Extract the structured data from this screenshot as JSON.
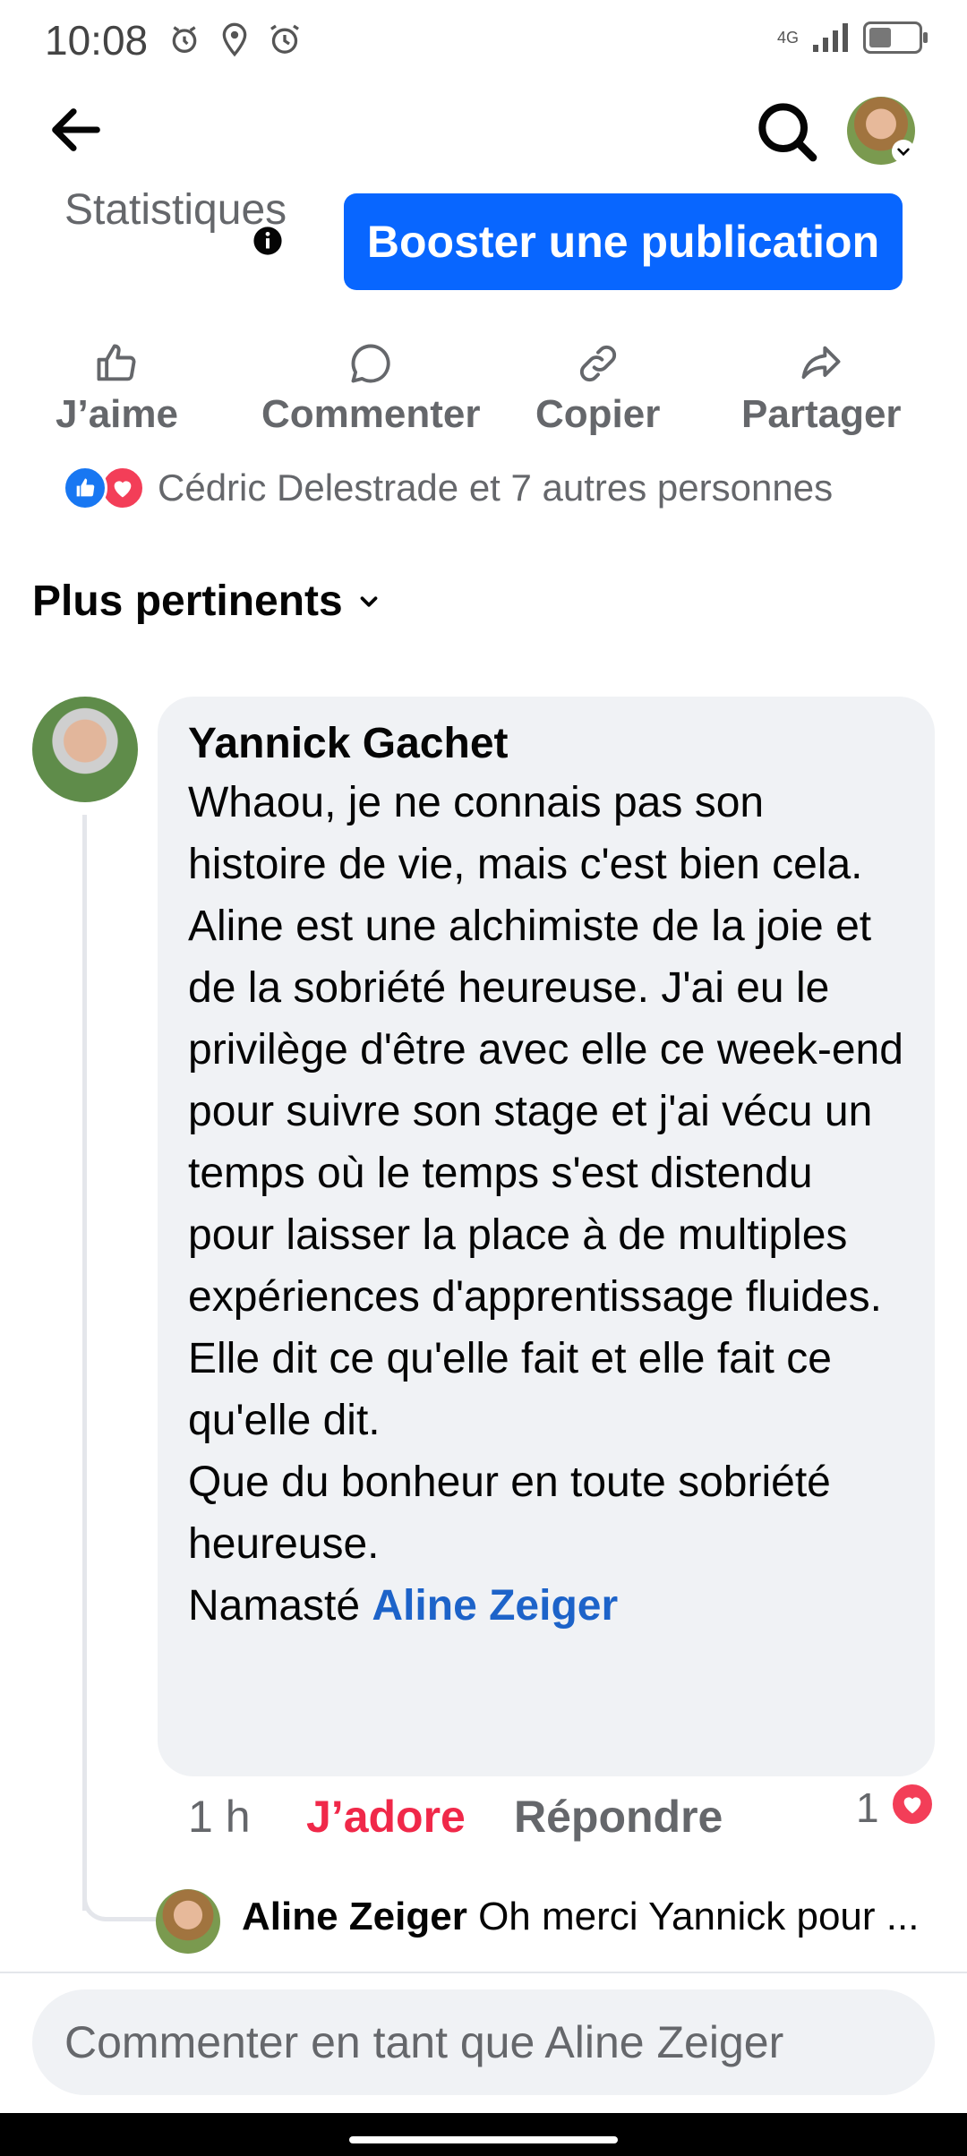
{
  "status_bar": {
    "time": "10:08",
    "network": "4G",
    "battery_level": 0.45
  },
  "header": {
    "back_icon": "arrow-left-icon",
    "search_icon": "search-icon"
  },
  "stats": {
    "label": "Statistiques",
    "boost_label": "Booster une publication"
  },
  "actions": [
    {
      "label": "J’aime",
      "icon": "thumbs-up-icon"
    },
    {
      "label": "Commenter",
      "icon": "comment-bubble-icon"
    },
    {
      "label": "Copier",
      "icon": "link-icon"
    },
    {
      "label": "Partager",
      "icon": "share-arrow-icon"
    }
  ],
  "reactions": {
    "text": "Cédric Delestrade et 7 autres personnes"
  },
  "sort": {
    "label": "Plus pertinents"
  },
  "comment": {
    "author": "Yannick Gachet",
    "text": "Whaou, je ne connais pas son histoire de vie, mais c'est bien cela. Aline est une alchimiste de la joie et de la sobriété heureuse. J'ai eu le privilège d'être avec elle ce week-end pour suivre son stage et j'ai vécu un temps où le temps s'est distendu pour laisser la place à de multiples expériences d'apprentissage fluides. Elle dit ce qu'elle fait et elle fait ce qu'elle dit.\nQue du bonheur en toute sobriété heureuse.\nNamasté ",
    "mention": "Aline Zeiger",
    "time": "1 h",
    "love_label": "J’adore",
    "reply_label": "Répondre",
    "reaction_count": "1"
  },
  "reply": {
    "author": "Aline Zeiger",
    "text": "Oh merci Yannick pour ..."
  },
  "composer": {
    "placeholder": "Commenter en tant que Aline Zeiger"
  },
  "colors": {
    "primary": "#0866ff",
    "love": "#f02849",
    "like": "#1877f2",
    "secondary_text": "#65676b",
    "bubble": "#f0f2f5",
    "mention": "#1d63c9"
  }
}
